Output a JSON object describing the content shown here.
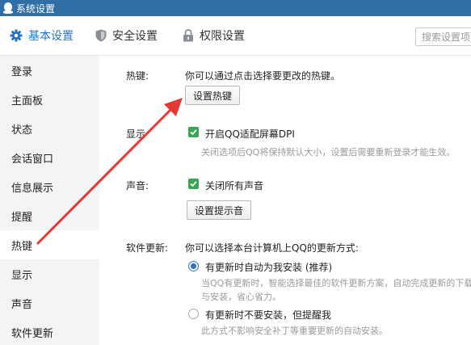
{
  "window": {
    "title": "系统设置"
  },
  "tabs": [
    {
      "label": "基本设置",
      "icon": "gear-icon"
    },
    {
      "label": "安全设置",
      "icon": "shield-icon"
    },
    {
      "label": "权限设置",
      "icon": "lock-icon"
    }
  ],
  "search": {
    "placeholder": "搜索设置项"
  },
  "sidebar": {
    "items": [
      {
        "label": "登录"
      },
      {
        "label": "主面板"
      },
      {
        "label": "状态"
      },
      {
        "label": "会话窗口"
      },
      {
        "label": "信息展示"
      },
      {
        "label": "提醒"
      },
      {
        "label": "热键"
      },
      {
        "label": "显示"
      },
      {
        "label": "声音"
      },
      {
        "label": "软件更新"
      }
    ],
    "selected": "热键"
  },
  "hotkey": {
    "label": "热键:",
    "description": "你可以通过点击选择要更改的热键。",
    "button": "设置热键"
  },
  "display": {
    "label": "显示",
    "checkbox_label": "开启QQ适配屏幕DPI",
    "checked": true,
    "hint": "关闭选项后QQ将保持默认大小，设置后需要重新登录才能生效。"
  },
  "sound": {
    "label": "声音:",
    "checkbox_label": "关闭所有声音",
    "checked": true,
    "button": "设置提示音"
  },
  "update": {
    "label": "软件更新:",
    "description": "你可以选择本台计算机上QQ的更新方式:",
    "options": [
      {
        "label": "有更新时自动为我安装 (推荐)",
        "selected": true,
        "hint1": "当QQ有更新时，智能选择最佳的软件更新方案，自动完成更新的下载",
        "hint2": "与安装，省心省力。"
      },
      {
        "label": "有更新时不要安装，但提醒我",
        "selected": false,
        "hint1": "此方式不影响安全补丁等重要更新的自动安装。"
      }
    ]
  },
  "colors": {
    "titlebar": "#2f6fa6",
    "accent": "#2a73c4",
    "check": "#34a853",
    "annotation_arrow": "#e53935"
  }
}
